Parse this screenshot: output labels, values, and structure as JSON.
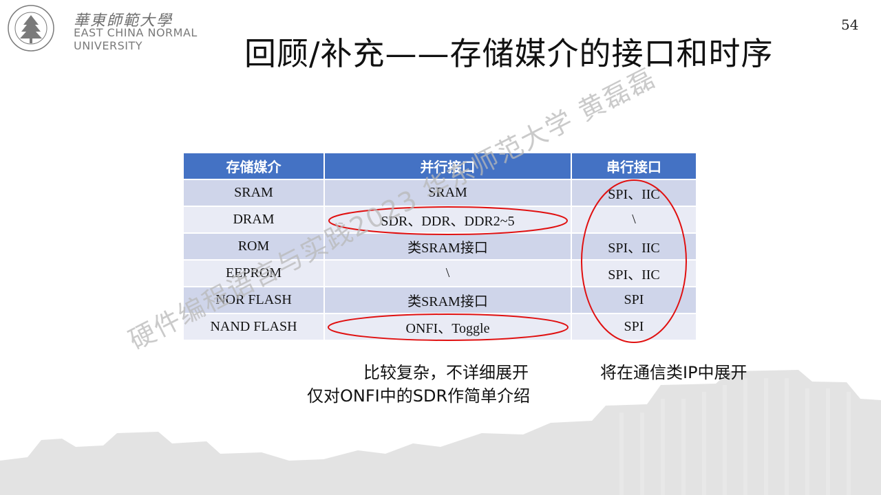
{
  "header": {
    "logo_cn": "華東師範大學",
    "logo_en_line1": "EAST CHINA NORMAL",
    "logo_en_line2": "UNIVERSITY",
    "seal_text": "EAST CHINA NORMAL UNIVERSITY",
    "page_number": "54",
    "title": "回顾/补充——存储媒介的接口和时序"
  },
  "table": {
    "headers": [
      "存储媒介",
      "并行接口",
      "串行接口"
    ],
    "rows": [
      [
        "SRAM",
        "SRAM",
        "SPI、IIC"
      ],
      [
        "DRAM",
        "SDR、DDR、DDR2~5",
        "\\"
      ],
      [
        "ROM",
        "类SRAM接口",
        "SPI、IIC"
      ],
      [
        "EEPROM",
        "\\",
        "SPI、IIC"
      ],
      [
        "NOR FLASH",
        "类SRAM接口",
        "SPI"
      ],
      [
        "NAND FLASH",
        "ONFI、Toggle",
        "SPI"
      ]
    ]
  },
  "notes": {
    "left_line1": "比较复杂，不详细展开",
    "left_line2": "仅对ONFI中的SDR作简单介绍",
    "right": "将在通信类IP中展开"
  },
  "watermark": "硬件编程语言与实践2023 华东师范大学 黄磊磊",
  "colors": {
    "header_blue": "#4472c4",
    "row_dark": "#cfd5ea",
    "row_light": "#e9ebf5",
    "annotation_red": "#e01010"
  }
}
